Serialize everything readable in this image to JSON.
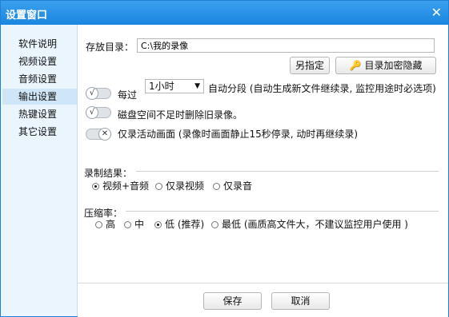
{
  "window": {
    "title": "设置窗口",
    "close_glyph": "✕"
  },
  "sidebar": {
    "items": [
      {
        "label": "软件说明",
        "active": false
      },
      {
        "label": "视频设置",
        "active": false
      },
      {
        "label": "音频设置",
        "active": false
      },
      {
        "label": "输出设置",
        "active": true
      },
      {
        "label": "热键设置",
        "active": false
      },
      {
        "label": "其它设置",
        "active": false
      }
    ]
  },
  "output": {
    "save_dir_label": "存放目录：",
    "save_dir_value": "C:\\我的录像",
    "save_as_button": "另指定",
    "encrypt_button": "目录加密隐藏",
    "key_icon": "key-icon",
    "key_glyph": "🔑",
    "every_label": "每过",
    "interval_value": "1小时",
    "select_arrow": "▼",
    "auto_split_text": "自动分段 (自动生成新文件继续录, 监控用途时必选项)",
    "disk_delete_text": "磁盘空间不足时删除旧录像。",
    "active_only_text": "仅录活动画面 (录像时画面静止15秒停录, 动时再继续录)",
    "toggle_on_glyph": "√",
    "toggle_off_glyph": "✕"
  },
  "record_result": {
    "title": "录制结果：",
    "options": [
      "视频+音频",
      "仅录视频",
      "仅录音"
    ],
    "selected_index": 0
  },
  "compression": {
    "title": "压缩率：",
    "options": [
      "高",
      "中",
      "低 (推荐)",
      "最低 (画质高文件大，不建议监控用户使用 )"
    ],
    "selected_index": 2
  },
  "footer": {
    "save_button": "保存",
    "cancel_button": "取消"
  }
}
